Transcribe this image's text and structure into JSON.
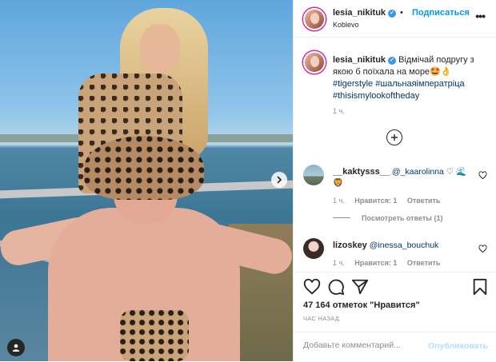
{
  "post": {
    "username": "lesia_nikituk",
    "location": "Koblevo",
    "follow_label": "Подписаться",
    "dot": "•",
    "caption_text": "Відмічай подругу з якою б поїхала на море🤩👌",
    "hashtags": [
      "#tigerstyle",
      "#шальнаяімператріца",
      "#thisismylookoftheday"
    ],
    "caption_time": "1 ч.",
    "comments": [
      {
        "username": "__kaktysss__",
        "mention": "@_kaarolinna",
        "emoji": "♡ 🌊 🦁",
        "time": "1 ч.",
        "reply_label": "Нравится: 1",
        "answer_label": "Ответить"
      },
      {
        "username": "lizoskey",
        "mention": "@inessa_bouchuk",
        "time": "1 ч.",
        "reply_label": "Нравится: 1",
        "answer_label": "Ответить"
      }
    ],
    "view_replies_label": "Посмотреть ответы (1)",
    "likes_text": "47 164 отметок \"Нравится\"",
    "time_ago": "ЧАС НАЗАД",
    "comment_placeholder": "Добавьте комментарий...",
    "publish_label": "Опубликовать"
  },
  "icons": {
    "verified": "verified-badge-icon",
    "more": "more-options-icon",
    "plus": "plus-circle-icon",
    "heart": "heart-icon",
    "comment": "comment-icon",
    "share": "share-icon",
    "bookmark": "bookmark-icon",
    "next": "chevron-right-icon",
    "user_tag": "user-tag-icon"
  },
  "colors": {
    "accent": "#0095f6",
    "hashtag": "#00376b",
    "muted": "#8e8e8e",
    "publish_disabled": "#b2dffc"
  }
}
